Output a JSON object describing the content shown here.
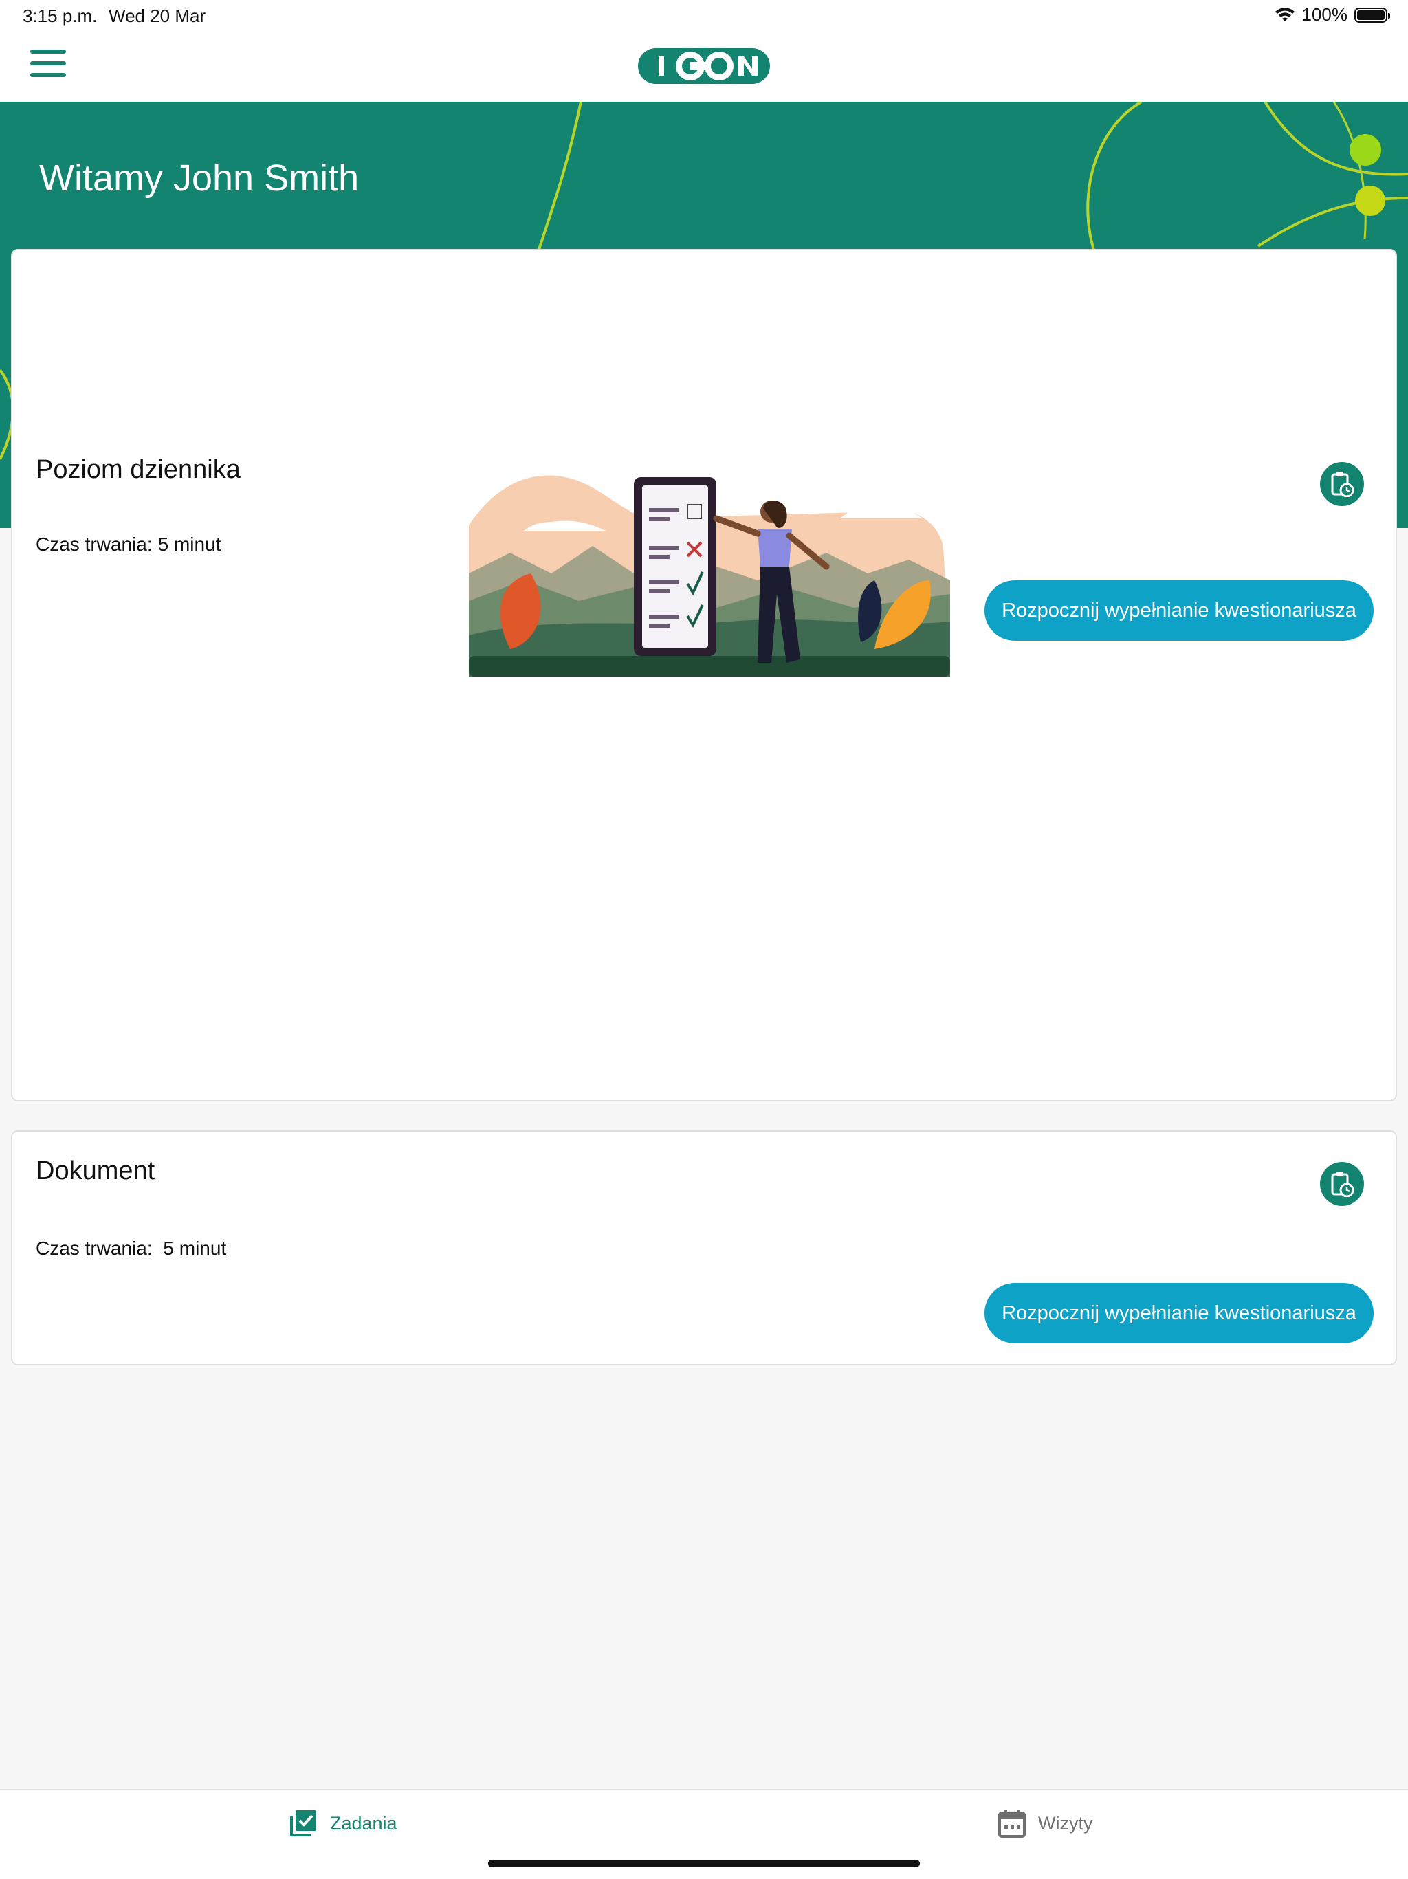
{
  "status_bar": {
    "time": "3:15 p.m.",
    "date": "Wed 20 Mar",
    "battery": "100%"
  },
  "header": {
    "logo_text": "ICON",
    "menu_icon": "hamburger-menu-icon"
  },
  "hero": {
    "greeting": "Witamy John Smith"
  },
  "tasks": [
    {
      "title": "Poziom dziennika",
      "duration_label": "Czas trwania:",
      "duration_value": "5 minut",
      "button_label": "Rozpocznij wypełnianie kwestionariusza",
      "icon": "clipboard-clock-icon"
    },
    {
      "title": "Dokument",
      "duration_label": "Czas trwania:",
      "duration_value": "5 minut",
      "button_label": "Rozpocznij wypełnianie kwestionariusza",
      "icon": "clipboard-clock-icon"
    }
  ],
  "tabbar": {
    "tasks_label": "Zadania",
    "visits_label": "Wizyty",
    "tasks_icon": "task-check-icon",
    "visits_icon": "calendar-icon"
  },
  "colors": {
    "brand": "#138470",
    "button": "#0ea2c7",
    "accent_lime": "#9bd81a"
  }
}
